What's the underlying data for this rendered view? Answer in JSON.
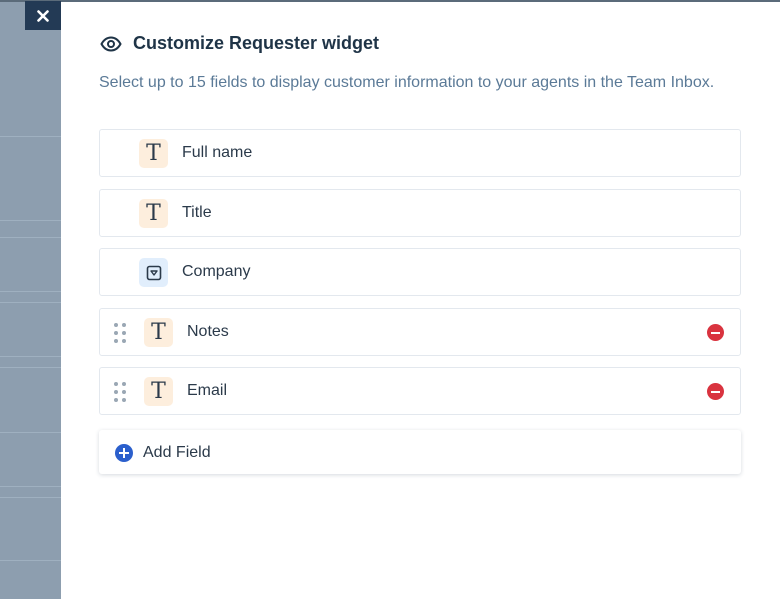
{
  "widget": {
    "title": "Customize Requester widget",
    "description": "Select up to 15 fields to display customer information to your agents in the Team Inbox."
  },
  "fields": [
    {
      "label": "Full name",
      "type": "text",
      "icon": "text-type-icon",
      "removable": false,
      "draggable": false
    },
    {
      "label": "Title",
      "type": "text",
      "icon": "text-type-icon",
      "removable": false,
      "draggable": false
    },
    {
      "label": "Company",
      "type": "dropdown",
      "icon": "dropdown-type-icon",
      "removable": false,
      "draggable": false
    },
    {
      "label": "Notes",
      "type": "text",
      "icon": "text-type-icon",
      "removable": true,
      "draggable": true
    },
    {
      "label": "Email",
      "type": "text",
      "icon": "text-type-icon",
      "removable": true,
      "draggable": true
    }
  ],
  "add_field_label": "Add Field",
  "colors": {
    "overlay": "#8d9eaf",
    "close_button": "#233a55",
    "title": "#1f3447",
    "description": "#5b7a97",
    "text_icon_bg": "#fdeedd",
    "dropdown_icon_bg": "#e1eefc",
    "remove": "#d9333f",
    "add": "#2b5fcc"
  }
}
